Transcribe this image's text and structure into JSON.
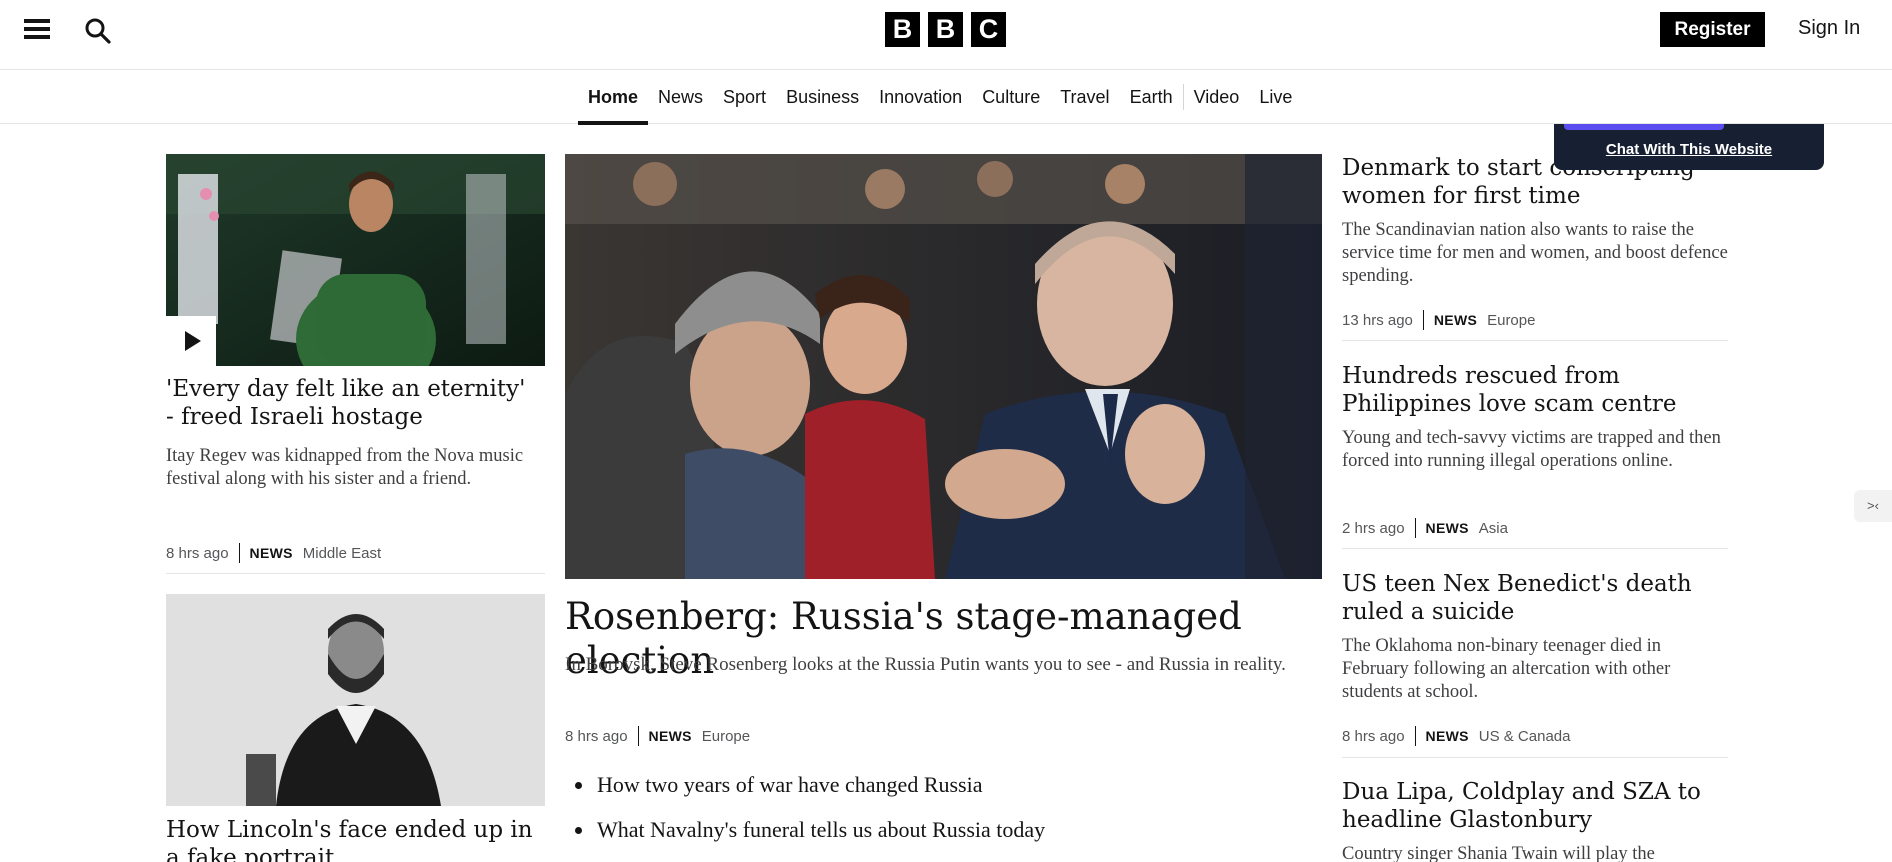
{
  "header": {
    "logo_letters": [
      "B",
      "B",
      "C"
    ],
    "register_label": "Register",
    "signin_label": "Sign In"
  },
  "nav": {
    "items": [
      {
        "label": "Home",
        "active": true
      },
      {
        "label": "News"
      },
      {
        "label": "Sport"
      },
      {
        "label": "Business"
      },
      {
        "label": "Innovation"
      },
      {
        "label": "Culture"
      },
      {
        "label": "Travel"
      },
      {
        "label": "Earth"
      },
      {
        "label": "Video"
      },
      {
        "label": "Live"
      }
    ]
  },
  "left_column": {
    "story1": {
      "headline": "'Every day felt like an eternity' - freed Israeli hostage",
      "summary": "Itay Regev was kidnapped from the Nova music festival along with his sister and a friend.",
      "time": "8 hrs ago",
      "tag": "NEWS",
      "region": "Middle East",
      "has_video": true
    },
    "story2": {
      "headline": "How Lincoln's face ended up in a fake portrait"
    }
  },
  "center": {
    "headline": "Rosenberg: Russia's stage-managed election",
    "summary": "In Borovsk, Steve Rosenberg looks at the Russia Putin wants you to see - and Russia in reality.",
    "time": "8 hrs ago",
    "tag": "NEWS",
    "region": "Europe",
    "related": [
      "How two years of war have changed Russia",
      "What Navalny's funeral tells us about Russia today"
    ]
  },
  "right_column": {
    "stories": [
      {
        "headline": "Denmark to start conscripting women for first time",
        "summary": "The Scandinavian nation also wants to raise the service time for men and women, and boost defence spending.",
        "time": "13 hrs ago",
        "tag": "NEWS",
        "region": "Europe"
      },
      {
        "headline": "Hundreds rescued from Philippines love scam centre",
        "summary": "Young and tech-savvy victims are trapped and then forced into running illegal operations online.",
        "time": "2 hrs ago",
        "tag": "NEWS",
        "region": "Asia"
      },
      {
        "headline": "US teen Nex Benedict's death ruled a suicide",
        "summary": "The Oklahoma non-binary teenager died in February following an altercation with other students at school.",
        "time": "8 hrs ago",
        "tag": "NEWS",
        "region": "US & Canada"
      },
      {
        "headline": "Dua Lipa, Coldplay and SZA to headline Glastonbury",
        "summary": "Country singer Shania Twain will play the"
      }
    ]
  },
  "chat_widget": {
    "link_label": "Chat With This Website"
  },
  "edge_tab": {
    "glyph": ">‹"
  },
  "colors": {
    "brand_black": "#000000",
    "text": "#141414",
    "muted": "#545658",
    "chat_bg": "#172033",
    "chat_accent": "#5b4cf0"
  }
}
